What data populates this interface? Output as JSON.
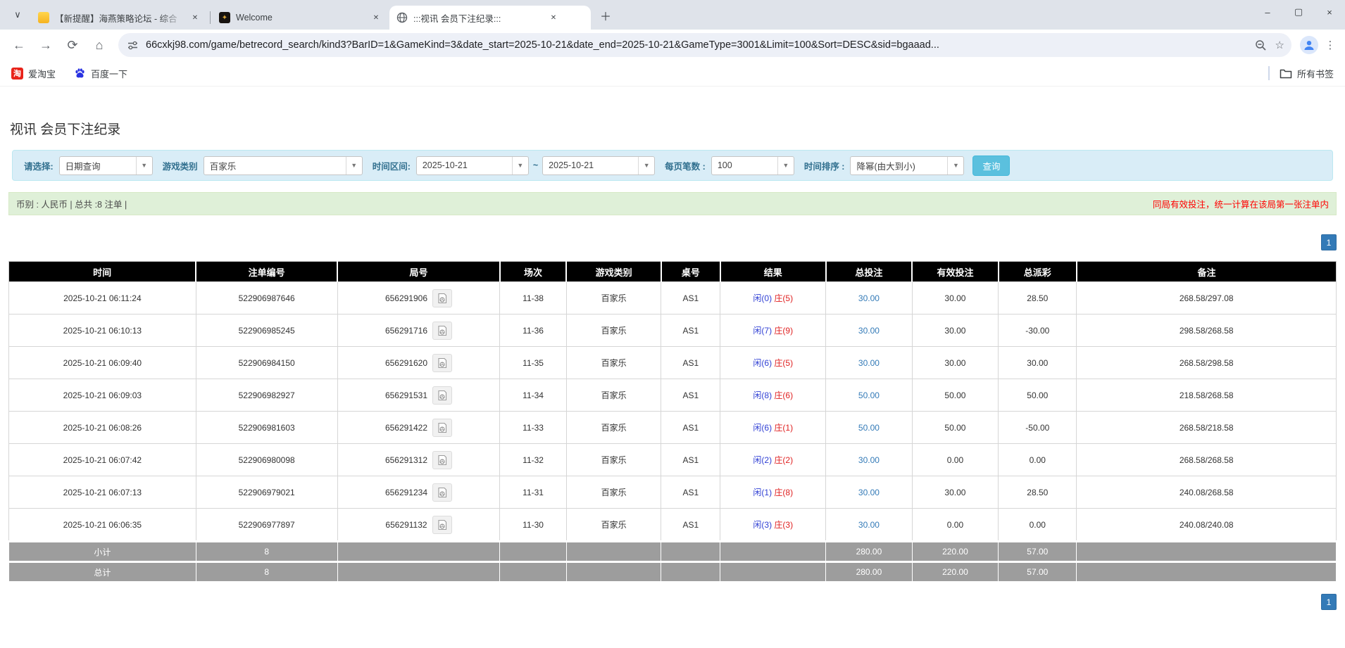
{
  "colors": {
    "accent_blue": "#337ab7",
    "search_button": "#5bc0de",
    "filter_bg": "#d9edf7",
    "summary_bg": "#dff0d8",
    "header_bg": "#000000",
    "footer_bg": "#9d9d9d",
    "warning_red": "#ff0000",
    "player_blue": "#2f3fd4",
    "banker_red": "#e02020"
  },
  "icons": {
    "tab_search": "∨",
    "close": "✕",
    "new_tab": "＋",
    "back": "←",
    "forward": "→",
    "reload": "⟳",
    "home": "⌂",
    "star": "☆",
    "menu": "⋮",
    "minimize": "–",
    "maximize": "▢",
    "win_close": "×",
    "caret": "▼",
    "taobao_char": "淘",
    "welcome_glyph": "✦"
  },
  "browser": {
    "tabs": [
      {
        "title": "【新提醒】海燕策略论坛 - 综合"
      },
      {
        "title": "Welcome"
      },
      {
        "title": ":::视讯 会员下注纪录:::"
      }
    ],
    "url": "66cxkj98.com/game/betrecord_search/kind3?BarID=1&GameKind=3&date_start=2025-10-21&date_end=2025-10-21&GameType=3001&Limit=100&Sort=DESC&sid=bgaaad...",
    "bookmarks": [
      {
        "label": "爱淘宝"
      },
      {
        "label": "百度一下"
      }
    ],
    "all_bookmarks": "所有书签"
  },
  "page": {
    "title": "视讯 会员下注纪录",
    "filters": {
      "select_label": "请选择:",
      "select_value": "日期查询",
      "game_label": "游戏类别",
      "game_value": "百家乐",
      "range_label": "时间区间:",
      "date_start": "2025-10-21",
      "tilde": "~",
      "date_end": "2025-10-21",
      "per_page_label": "每页笔数 :",
      "per_page_value": "100",
      "sort_label": "时间排序 :",
      "sort_value": "降幂(由大到小)",
      "search_label": "查询"
    },
    "summary": {
      "left": "币别 : 人民币 | 总共 :8 注单 |",
      "right": "同局有效投注，统一计算在该局第一张注单内"
    },
    "pagination": {
      "page": "1"
    },
    "table": {
      "headers": [
        "时间",
        "注单编号",
        "局号",
        "场次",
        "游戏类别",
        "桌号",
        "结果",
        "总投注",
        "有效投注",
        "总派彩",
        "备注"
      ],
      "rows": [
        {
          "time": "2025-10-21 06:11:24",
          "bet_id": "522906987646",
          "round_id": "656291906",
          "session": "11-38",
          "game": "百家乐",
          "table_no": "AS1",
          "result_player": "闲(0)",
          "result_banker": "庄(5)",
          "total_bet": "30.00",
          "valid_bet": "30.00",
          "payout": "28.50",
          "note": "268.58/297.08"
        },
        {
          "time": "2025-10-21 06:10:13",
          "bet_id": "522906985245",
          "round_id": "656291716",
          "session": "11-36",
          "game": "百家乐",
          "table_no": "AS1",
          "result_player": "闲(7)",
          "result_banker": "庄(9)",
          "total_bet": "30.00",
          "valid_bet": "30.00",
          "payout": "-30.00",
          "note": "298.58/268.58"
        },
        {
          "time": "2025-10-21 06:09:40",
          "bet_id": "522906984150",
          "round_id": "656291620",
          "session": "11-35",
          "game": "百家乐",
          "table_no": "AS1",
          "result_player": "闲(6)",
          "result_banker": "庄(5)",
          "total_bet": "30.00",
          "valid_bet": "30.00",
          "payout": "30.00",
          "note": "268.58/298.58"
        },
        {
          "time": "2025-10-21 06:09:03",
          "bet_id": "522906982927",
          "round_id": "656291531",
          "session": "11-34",
          "game": "百家乐",
          "table_no": "AS1",
          "result_player": "闲(8)",
          "result_banker": "庄(6)",
          "total_bet": "50.00",
          "valid_bet": "50.00",
          "payout": "50.00",
          "note": "218.58/268.58"
        },
        {
          "time": "2025-10-21 06:08:26",
          "bet_id": "522906981603",
          "round_id": "656291422",
          "session": "11-33",
          "game": "百家乐",
          "table_no": "AS1",
          "result_player": "闲(6)",
          "result_banker": "庄(1)",
          "total_bet": "50.00",
          "valid_bet": "50.00",
          "payout": "-50.00",
          "note": "268.58/218.58"
        },
        {
          "time": "2025-10-21 06:07:42",
          "bet_id": "522906980098",
          "round_id": "656291312",
          "session": "11-32",
          "game": "百家乐",
          "table_no": "AS1",
          "result_player": "闲(2)",
          "result_banker": "庄(2)",
          "total_bet": "30.00",
          "valid_bet": "0.00",
          "payout": "0.00",
          "note": "268.58/268.58"
        },
        {
          "time": "2025-10-21 06:07:13",
          "bet_id": "522906979021",
          "round_id": "656291234",
          "session": "11-31",
          "game": "百家乐",
          "table_no": "AS1",
          "result_player": "闲(1)",
          "result_banker": "庄(8)",
          "total_bet": "30.00",
          "valid_bet": "30.00",
          "payout": "28.50",
          "note": "240.08/268.58"
        },
        {
          "time": "2025-10-21 06:06:35",
          "bet_id": "522906977897",
          "round_id": "656291132",
          "session": "11-30",
          "game": "百家乐",
          "table_no": "AS1",
          "result_player": "闲(3)",
          "result_banker": "庄(3)",
          "total_bet": "30.00",
          "valid_bet": "0.00",
          "payout": "0.00",
          "note": "240.08/240.08"
        }
      ],
      "subtotal": {
        "label": "小计",
        "count": "8",
        "total_bet": "280.00",
        "valid_bet": "220.00",
        "payout": "57.00"
      },
      "total": {
        "label": "总计",
        "count": "8",
        "total_bet": "280.00",
        "valid_bet": "220.00",
        "payout": "57.00"
      }
    }
  }
}
